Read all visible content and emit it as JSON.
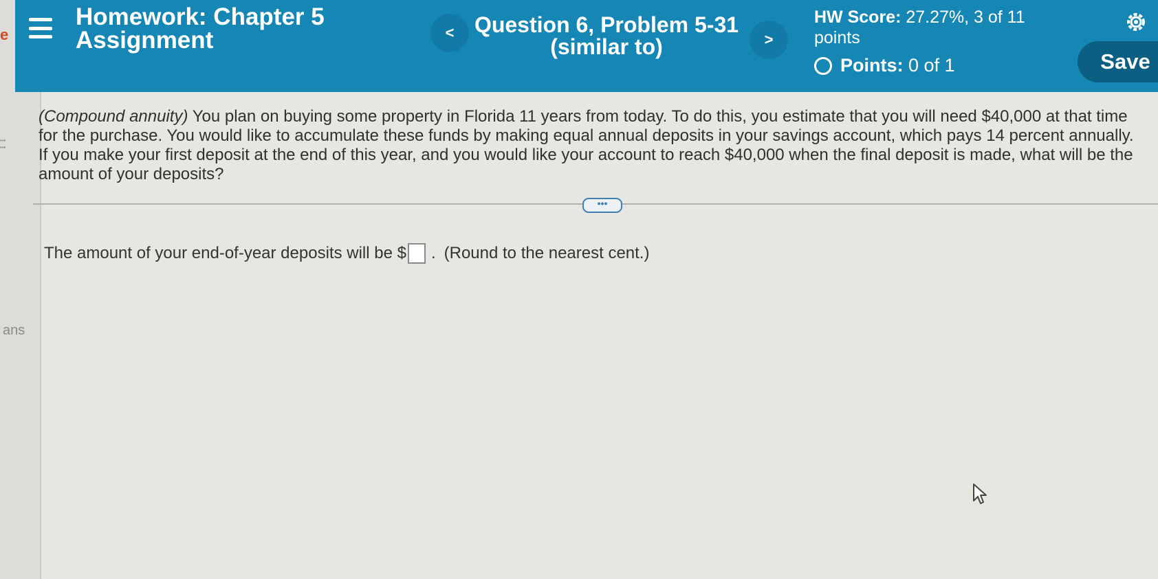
{
  "left_strip": {
    "ans_text": "ans"
  },
  "header": {
    "title_line1": "Homework: Chapter 5",
    "title_line2": "Assignment",
    "prev_label": "<",
    "next_label": ">",
    "question_line1": "Question 6, Problem 5-31",
    "question_line2": "(similar to)",
    "hw_score_label": "HW Score:",
    "hw_score_value": "27.27%, 3 of 11",
    "hw_score_suffix": "points",
    "points_label": "Points:",
    "points_value": "0 of 1",
    "save_label": "Save",
    "settings_icon": "gear-icon"
  },
  "question": {
    "topic": "(Compound annuity)",
    "body": " You plan on buying some property in Florida 11 years from today. To do this, you estimate that you will need $40,000 at that time for the purchase. You would like to accumulate these funds by making equal annual deposits in your savings account, which pays 14 percent annually. If you make your first deposit at the end of this year, and you would like your account to reach $40,000 when the final deposit is made, what will be the amount of your deposits?"
  },
  "more_label": "•••",
  "answer": {
    "prompt": "The amount of your end-of-year deposits will be $",
    "value": "",
    "suffix": ".",
    "note": "(Round to the nearest cent.)"
  },
  "colors": {
    "header_bg": "#1687b5",
    "save_bg": "#0b5f82",
    "page_bg": "#e7e6e1"
  }
}
